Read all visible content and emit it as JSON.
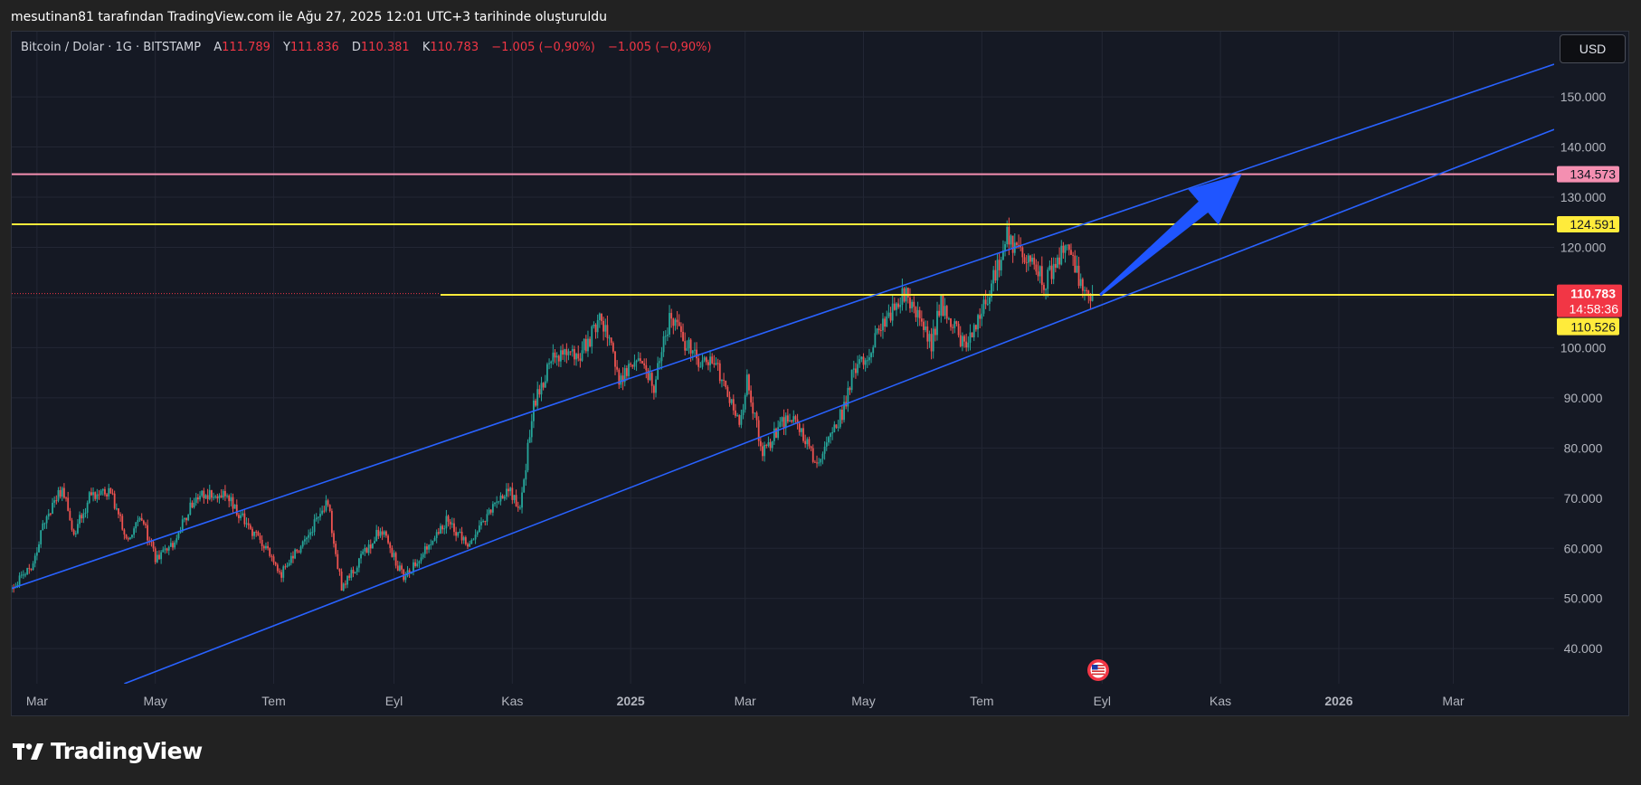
{
  "header": {
    "attribution": "mesutinan81 tarafından TradingView.com ile Ağu 27, 2025 12:01 UTC+3 tarihinde oluşturuldu"
  },
  "legend": {
    "symbol": "Bitcoin / Dolar · 1G · BITSTAMP",
    "open_label": "A",
    "open": "111.789",
    "high_label": "Y",
    "high": "111.836",
    "low_label": "D",
    "low": "110.381",
    "close_label": "K",
    "close": "110.783",
    "change": "−1.005 (−0,90%)",
    "change2": "−1.005 (−0,90%)"
  },
  "currency_button": "USD",
  "footer": {
    "brand": "TradingView"
  },
  "colors": {
    "up": "#26a69a",
    "down": "#ef5350",
    "channel": "#2962ff",
    "pink_level": "#f48fb1",
    "yellow_level": "#ffeb3b",
    "price_tag": "#f23645",
    "arrow": "#1f55ff"
  },
  "chart_data": {
    "type": "candlestick",
    "symbol": "BTCUSD",
    "interval": "1D",
    "ylim": [
      33000,
      163000
    ],
    "y_ticks": [
      40000,
      50000,
      60000,
      70000,
      80000,
      90000,
      100000,
      110000,
      120000,
      130000,
      140000,
      150000
    ],
    "y_tick_labels": [
      "40.000",
      "50.000",
      "60.000",
      "70.000",
      "80.000",
      "90.000",
      "100.000",
      "110.000",
      "120.000",
      "130.000",
      "140.000",
      "150.000"
    ],
    "x_range": [
      "2024-02-17",
      "2026-04-22"
    ],
    "x_ticks": [
      {
        "date": "2024-03-01",
        "label": "Mar",
        "bold": false
      },
      {
        "date": "2024-05-01",
        "label": "May",
        "bold": false
      },
      {
        "date": "2024-07-01",
        "label": "Tem",
        "bold": false
      },
      {
        "date": "2024-09-01",
        "label": "Eyl",
        "bold": false
      },
      {
        "date": "2024-11-01",
        "label": "Kas",
        "bold": false
      },
      {
        "date": "2025-01-01",
        "label": "2025",
        "bold": true
      },
      {
        "date": "2025-03-01",
        "label": "Mar",
        "bold": false
      },
      {
        "date": "2025-05-01",
        "label": "May",
        "bold": false
      },
      {
        "date": "2025-07-01",
        "label": "Tem",
        "bold": false
      },
      {
        "date": "2025-09-01",
        "label": "Eyl",
        "bold": false
      },
      {
        "date": "2025-11-01",
        "label": "Kas",
        "bold": false
      },
      {
        "date": "2026-01-01",
        "label": "2026",
        "bold": true
      },
      {
        "date": "2026-03-01",
        "label": "Mar",
        "bold": false
      }
    ],
    "grid": true,
    "price_path": [
      [
        "2024-02-17",
        52000
      ],
      [
        "2024-02-28",
        57000
      ],
      [
        "2024-03-05",
        66000
      ],
      [
        "2024-03-14",
        72000
      ],
      [
        "2024-03-20",
        63000
      ],
      [
        "2024-03-28",
        70000
      ],
      [
        "2024-04-08",
        71000
      ],
      [
        "2024-04-17",
        61500
      ],
      [
        "2024-04-24",
        66000
      ],
      [
        "2024-05-01",
        58000
      ],
      [
        "2024-05-10",
        61000
      ],
      [
        "2024-05-21",
        70000
      ],
      [
        "2024-06-05",
        71000
      ],
      [
        "2024-06-15",
        66000
      ],
      [
        "2024-06-25",
        61000
      ],
      [
        "2024-07-05",
        55000
      ],
      [
        "2024-07-14",
        60000
      ],
      [
        "2024-07-29",
        69000
      ],
      [
        "2024-08-05",
        52000
      ],
      [
        "2024-08-15",
        58000
      ],
      [
        "2024-08-25",
        64000
      ],
      [
        "2024-09-06",
        54000
      ],
      [
        "2024-09-15",
        59000
      ],
      [
        "2024-09-28",
        65500
      ],
      [
        "2024-10-10",
        60000
      ],
      [
        "2024-10-21",
        68000
      ],
      [
        "2024-10-29",
        72000
      ],
      [
        "2024-11-05",
        68500
      ],
      [
        "2024-11-12",
        88000
      ],
      [
        "2024-11-22",
        99000
      ],
      [
        "2024-12-05",
        98000
      ],
      [
        "2024-12-17",
        106000
      ],
      [
        "2024-12-26",
        94000
      ],
      [
        "2025-01-05",
        98000
      ],
      [
        "2025-01-13",
        92000
      ],
      [
        "2025-01-21",
        106000
      ],
      [
        "2025-02-03",
        98000
      ],
      [
        "2025-02-15",
        96000
      ],
      [
        "2025-02-26",
        84000
      ],
      [
        "2025-03-02",
        93000
      ],
      [
        "2025-03-10",
        79000
      ],
      [
        "2025-03-24",
        87000
      ],
      [
        "2025-04-07",
        77000
      ],
      [
        "2025-04-20",
        87000
      ],
      [
        "2025-04-25",
        94000
      ],
      [
        "2025-05-09",
        103000
      ],
      [
        "2025-05-22",
        111000
      ],
      [
        "2025-06-05",
        101000
      ],
      [
        "2025-06-10",
        109000
      ],
      [
        "2025-06-22",
        100000
      ],
      [
        "2025-07-03",
        109000
      ],
      [
        "2025-07-14",
        122000
      ],
      [
        "2025-07-23",
        118000
      ],
      [
        "2025-08-03",
        113000
      ],
      [
        "2025-08-14",
        121000
      ],
      [
        "2025-08-20",
        113000
      ],
      [
        "2025-08-27",
        110783
      ]
    ],
    "channel_lines": [
      {
        "name": "",
        "from": [
          "2024-02-17",
          52000
        ],
        "to": [
          "2026-04-22",
          156500
        ]
      },
      {
        "name": "",
        "from": [
          "2024-04-15",
          33000
        ],
        "to": [
          "2026-04-22",
          143500
        ]
      }
    ],
    "horizontal_levels": [
      {
        "value": 134573,
        "label": "134.573",
        "color": "#f48fb1",
        "from": "2024-02-17"
      },
      {
        "value": 124591,
        "label": "124.591",
        "color": "#ffeb3b",
        "from": "2024-02-17"
      },
      {
        "value": 110526,
        "label": "110.526",
        "color": "#ffeb3b",
        "from": "2024-09-25"
      }
    ],
    "last_price": {
      "value": 110783,
      "label": "110.783",
      "countdown": "14:58:36"
    },
    "arrow": {
      "from": [
        "2025-08-31",
        110500
      ],
      "to": [
        "2025-11-12",
        134600
      ]
    },
    "event_marker": {
      "date": "2025-08-30"
    }
  }
}
